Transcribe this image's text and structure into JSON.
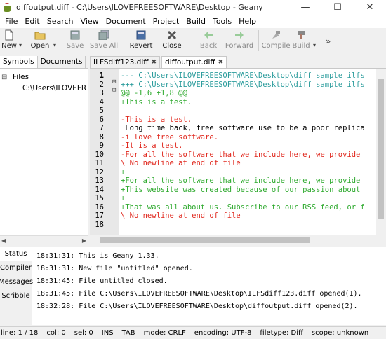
{
  "window": {
    "title": "diffoutput.diff - C:\\Users\\ILOVEFREESOFTWARE\\Desktop - Geany",
    "min_glyph": "—",
    "max_glyph": "☐",
    "close_glyph": "✕"
  },
  "menu": [
    "File",
    "Edit",
    "Search",
    "View",
    "Document",
    "Project",
    "Build",
    "Tools",
    "Help"
  ],
  "toolbar": {
    "new": "New",
    "open": "Open",
    "save": "Save",
    "save_all": "Save All",
    "revert": "Revert",
    "close": "Close",
    "back": "Back",
    "forward": "Forward",
    "compile": "Compile",
    "build": "Build",
    "more": "»"
  },
  "sidebar": {
    "tabs": [
      "Symbols",
      "Documents"
    ],
    "tree_root": "Files",
    "tree_child": "C:\\Users\\ILOVEFRE"
  },
  "doc_tabs": [
    {
      "label": "ILFSdiff123.diff"
    },
    {
      "label": "diffoutput.diff"
    }
  ],
  "code_lines": [
    {
      "n": "1",
      "text": "--- C:\\Users\\ILOVEFREESOFTWARE\\Desktop\\diff sample ilfs",
      "color": "cyan"
    },
    {
      "n": "2",
      "text": "+++ C:\\Users\\ILOVEFREESOFTWARE\\Desktop\\diff sample ilfs",
      "color": "cyan"
    },
    {
      "n": "3",
      "text": "@@ -1,6 +1,8 @@",
      "color": "green"
    },
    {
      "n": "4",
      "text": "+This is a test.",
      "color": "green"
    },
    {
      "n": "5",
      "text": "",
      "color": "black"
    },
    {
      "n": "6",
      "text": "-This is a test.",
      "color": "red"
    },
    {
      "n": "7",
      "text": " Long time back, free software use to be a poor replica",
      "color": "black"
    },
    {
      "n": "8",
      "text": "-i love free software.",
      "color": "red"
    },
    {
      "n": "9",
      "text": "-It is a test.",
      "color": "red"
    },
    {
      "n": "10",
      "text": "-For all the software that we include here, we provide",
      "color": "red"
    },
    {
      "n": "11",
      "text": "\\ No newline at end of file",
      "color": "red"
    },
    {
      "n": "12",
      "text": "+",
      "color": "green"
    },
    {
      "n": "13",
      "text": "+For all the software that we include here, we provide",
      "color": "green"
    },
    {
      "n": "14",
      "text": "+This website was created because of our passion about",
      "color": "green"
    },
    {
      "n": "15",
      "text": "+",
      "color": "green"
    },
    {
      "n": "16",
      "text": "+That was all about us. Subscribe to our RSS feed, or f",
      "color": "green"
    },
    {
      "n": "17",
      "text": "\\ No newline at end of file",
      "color": "red"
    },
    {
      "n": "18",
      "text": "",
      "color": "black"
    }
  ],
  "message_tabs": [
    "Status",
    "Compiler",
    "Messages",
    "Scribble"
  ],
  "messages": [
    "18:31:31: This is Geany 1.33.",
    "18:31:31: New file \"untitled\" opened.",
    "18:31:45: File untitled closed.",
    "18:31:45: File C:\\Users\\ILOVEFREESOFTWARE\\Desktop\\ILFSdiff123.diff opened(1).",
    "18:32:28: File C:\\Users\\ILOVEFREESOFTWARE\\Desktop\\diffoutput.diff opened(2)."
  ],
  "status": {
    "line": "line: 1 / 18",
    "col": "col: 0",
    "sel": "sel: 0",
    "ins": "INS",
    "tab": "TAB",
    "mode": "mode: CRLF",
    "encoding": "encoding: UTF-8",
    "filetype": "filetype: Diff",
    "scope": "scope: unknown"
  },
  "colors": {
    "cyan": "#2b9c9c",
    "green": "#2faa2f",
    "red": "#e0281e",
    "black": "#000000"
  }
}
